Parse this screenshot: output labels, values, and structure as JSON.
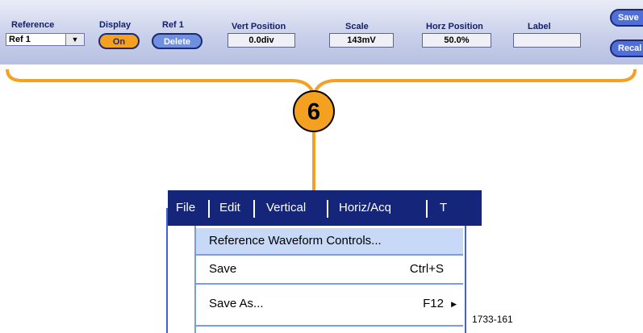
{
  "control_bar": {
    "reference_label": "Reference",
    "reference_value": "Ref 1",
    "display_label": "Display",
    "display_value": "On",
    "ref_label": "Ref 1",
    "delete_label": "Delete",
    "vert_position_label": "Vert Position",
    "vert_position_value": "0.0div",
    "scale_label": "Scale",
    "scale_value": "143mV",
    "horz_position_label": "Horz Position",
    "horz_position_value": "50.0%",
    "label_label": "Label",
    "label_value": "",
    "save_label": "Save",
    "recall_label": "Recal"
  },
  "callout": {
    "step_number": "6"
  },
  "menu_bar": {
    "items": [
      "File",
      "Edit",
      "Vertical",
      "Horiz/Acq",
      "T"
    ]
  },
  "dropdown": {
    "items": [
      {
        "label": "Reference Waveform Controls...",
        "shortcut": ""
      },
      {
        "label": "Save",
        "shortcut": "Ctrl+S"
      },
      {
        "label": "Save As...",
        "shortcut": "F12"
      }
    ]
  },
  "figure_id": "1733-161",
  "colors": {
    "menubar": "#14257a",
    "accent": "#f4a020",
    "highlight": "#c7d9f6"
  }
}
